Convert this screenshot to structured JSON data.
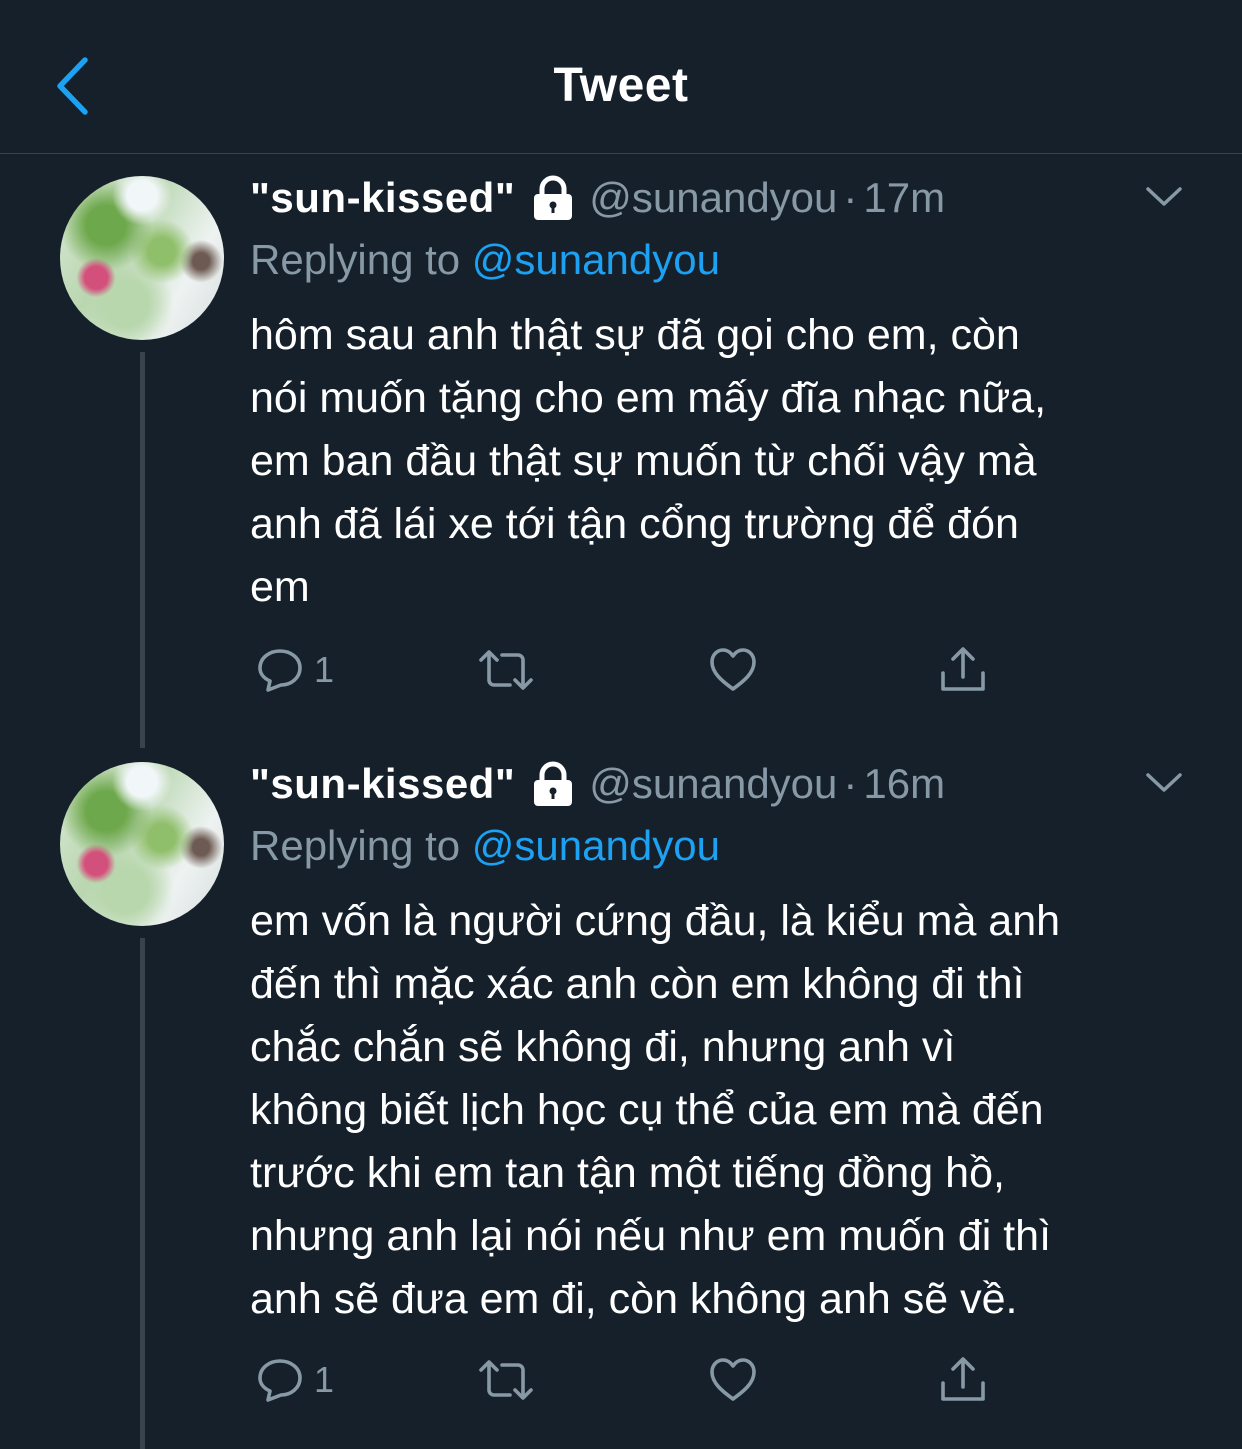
{
  "header": {
    "title": "Tweet"
  },
  "tweets": [
    {
      "display_name": "\"sun-kissed\"",
      "handle": "@sunandyou",
      "separator": "·",
      "time": "17m",
      "reply_prefix": "Replying to",
      "reply_handle": "@sunandyou",
      "text": "hôm sau anh thật sự đã gọi cho em, còn\nnói muốn tặng cho em mấy đĩa nhạc nữa,\nem ban đầu thật sự muốn từ chối vậy mà\nanh đã lái xe tới tận cổng trường để đón\nem",
      "reply_count": "1"
    },
    {
      "display_name": "\"sun-kissed\"",
      "handle": "@sunandyou",
      "separator": "·",
      "time": "16m",
      "reply_prefix": "Replying to",
      "reply_handle": "@sunandyou",
      "text": "em vốn là người cứng đầu, là kiểu mà anh\nđến thì mặc xác anh còn em không đi thì\nchắc chắn sẽ không đi, nhưng anh vì\nkhông biết lịch học cụ thể của em mà đến\ntrước khi em tan tận một tiếng đồng hồ,\nnhưng anh lại nói nếu như em muốn đi thì\nanh sẽ đưa em đi, còn không anh sẽ về.",
      "reply_count": "1"
    }
  ],
  "colors": {
    "background": "#15202b",
    "text_primary": "#ffffff",
    "text_secondary": "#8899a6",
    "accent": "#1da1f2",
    "divider": "#38444d"
  },
  "icons": [
    "back-chevron-icon",
    "lock-icon",
    "caret-down-icon",
    "reply-icon",
    "retweet-icon",
    "like-icon",
    "share-icon"
  ]
}
